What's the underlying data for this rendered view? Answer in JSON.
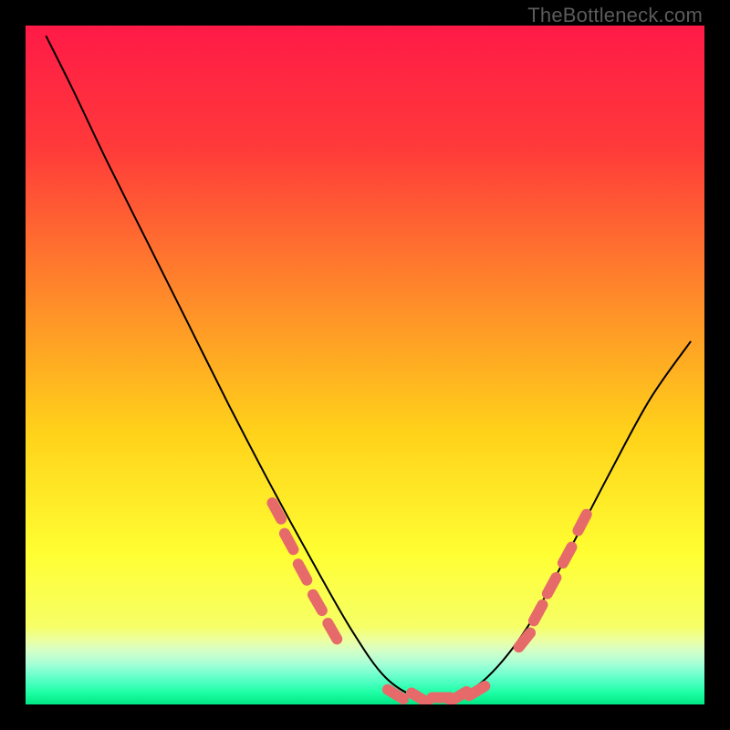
{
  "watermark": "TheBottleneck.com",
  "chart_data": {
    "type": "line",
    "title": "",
    "xlabel": "",
    "ylabel": "",
    "xlim": [
      0,
      1
    ],
    "ylim": [
      0,
      1
    ],
    "background_gradient": {
      "stops": [
        {
          "offset": 0.0,
          "color": "#ff1a47"
        },
        {
          "offset": 0.18,
          "color": "#ff3a3a"
        },
        {
          "offset": 0.4,
          "color": "#ff8a2a"
        },
        {
          "offset": 0.6,
          "color": "#ffd21a"
        },
        {
          "offset": 0.78,
          "color": "#ffff33"
        },
        {
          "offset": 0.885,
          "color": "#f6ff66"
        },
        {
          "offset": 0.905,
          "color": "#ecffa0"
        },
        {
          "offset": 0.918,
          "color": "#d9ffc2"
        },
        {
          "offset": 0.93,
          "color": "#c0ffd0"
        },
        {
          "offset": 0.942,
          "color": "#9fffd6"
        },
        {
          "offset": 0.955,
          "color": "#74ffcf"
        },
        {
          "offset": 0.968,
          "color": "#4affc0"
        },
        {
          "offset": 0.982,
          "color": "#1fffa6"
        },
        {
          "offset": 1.0,
          "color": "#00e884"
        }
      ]
    },
    "series": [
      {
        "name": "bottleneck-curve",
        "color": "#000000",
        "x": [
          0.03,
          0.07,
          0.12,
          0.18,
          0.24,
          0.3,
          0.36,
          0.42,
          0.48,
          0.53,
          0.58,
          0.63,
          0.68,
          0.74,
          0.8,
          0.86,
          0.92,
          0.98
        ],
        "y": [
          0.985,
          0.905,
          0.8,
          0.68,
          0.56,
          0.44,
          0.325,
          0.215,
          0.11,
          0.04,
          0.01,
          0.01,
          0.04,
          0.115,
          0.225,
          0.34,
          0.45,
          0.535
        ]
      }
    ],
    "markers": [
      {
        "name": "left-cluster",
        "shape": "capsule",
        "color": "#e66a6a",
        "points": [
          {
            "x": 0.37,
            "y": 0.285
          },
          {
            "x": 0.388,
            "y": 0.24
          },
          {
            "x": 0.408,
            "y": 0.195
          },
          {
            "x": 0.43,
            "y": 0.15
          },
          {
            "x": 0.452,
            "y": 0.108
          }
        ]
      },
      {
        "name": "bottom-cluster",
        "shape": "capsule",
        "color": "#e66a6a",
        "points": [
          {
            "x": 0.545,
            "y": 0.015
          },
          {
            "x": 0.58,
            "y": 0.01
          },
          {
            "x": 0.612,
            "y": 0.01
          },
          {
            "x": 0.638,
            "y": 0.012
          },
          {
            "x": 0.665,
            "y": 0.02
          }
        ]
      },
      {
        "name": "right-cluster",
        "shape": "capsule",
        "color": "#e66a6a",
        "points": [
          {
            "x": 0.735,
            "y": 0.095
          },
          {
            "x": 0.755,
            "y": 0.135
          },
          {
            "x": 0.775,
            "y": 0.175
          },
          {
            "x": 0.798,
            "y": 0.22
          },
          {
            "x": 0.82,
            "y": 0.268
          }
        ]
      }
    ]
  }
}
